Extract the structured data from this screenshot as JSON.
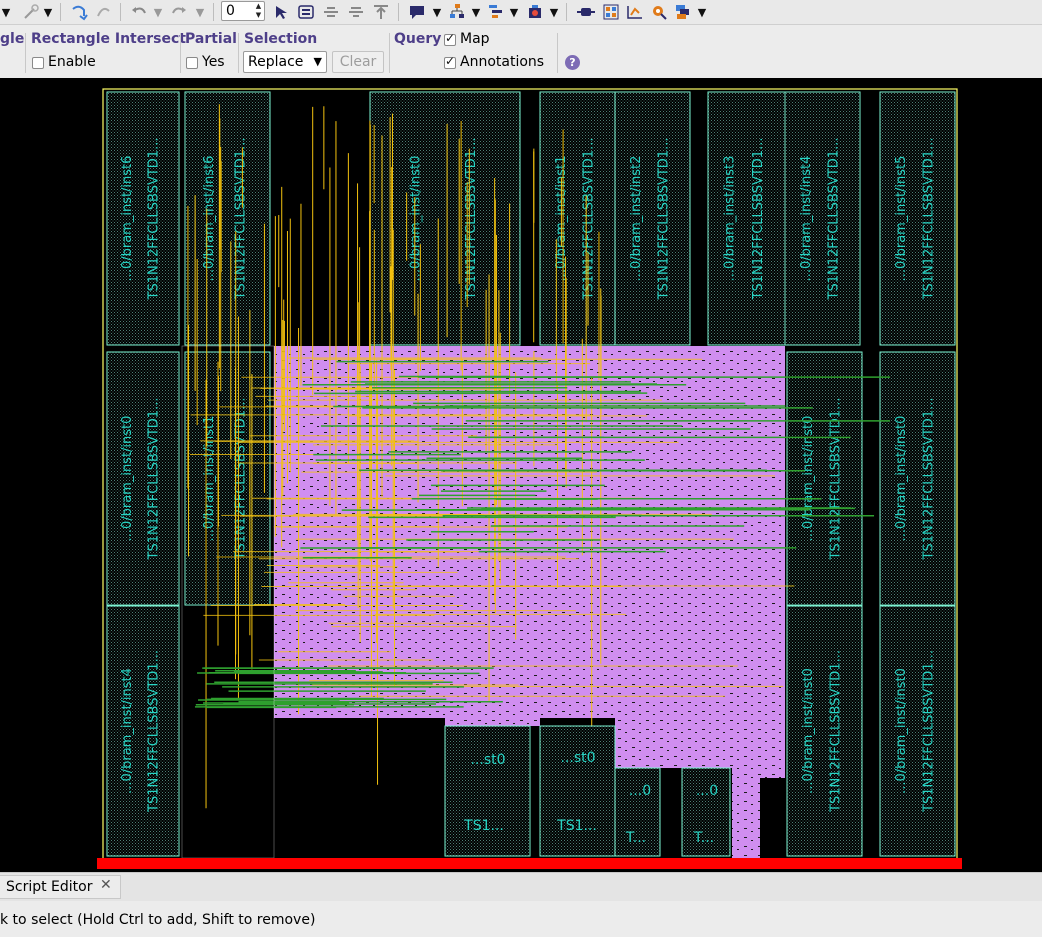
{
  "toolbar": {
    "spinner_value": "0",
    "icons": [
      "wand-icon",
      "wand-back-icon",
      "undo-icon",
      "redo-icon",
      "cursor-icon",
      "camera-icon",
      "align-center-icon",
      "align-middle-icon",
      "align-top-icon",
      "comment-icon",
      "hierarchy-icon",
      "grid-tree-icon",
      "package-icon",
      "chip-icon",
      "schematic-icon",
      "route-icon",
      "search-marker-icon",
      "layers-icon"
    ]
  },
  "options": {
    "partial_prev_label": "gle",
    "rect_intersect": {
      "title": "Rectangle Intersect",
      "enable_label": "Enable",
      "checked": false
    },
    "partial": {
      "title": "Partial",
      "yes_label": "Yes",
      "checked": false
    },
    "selection": {
      "title": "Selection",
      "mode": "Replace",
      "clear_label": "Clear"
    },
    "query": {
      "title": "Query",
      "map_label": "Map",
      "map_checked": true,
      "annotations_label": "Annotations",
      "annotations_checked": true
    },
    "help_label": "?"
  },
  "canvas": {
    "colors": {
      "background": "#000000",
      "cell_fill": "#2e4a44",
      "cell_border": "#7cf3d2",
      "cell_text": "#27d4c4",
      "logic": "#d08ef0",
      "wire_yellow": "#f3c20f",
      "wire_green": "#2fa02f",
      "die_outline": "#ffff66",
      "bottom_bar": "#ff0000"
    },
    "bram_labels": [
      {
        "name": "...0/bram_inst/inst6",
        "type": "TS1N12FFCLLSBSVTD1..."
      },
      {
        "name": "...0/bram_inst/inst6",
        "type": "TS1N12FFCLLSBSVTD1..."
      },
      {
        "name": "...0/bram_inst/inst0",
        "type": "TS1N12FFCLLSBSVTD1..."
      },
      {
        "name": "...0/bram_inst/inst1",
        "type": "TS1N12FFCLLSBSVTD1..."
      },
      {
        "name": "...0/bram_inst/inst2",
        "type": "TS1N12FFCLLSBSVTD1..."
      },
      {
        "name": "...0/bram_inst/inst3",
        "type": "TS1N12FFCLLSBSVTD1..."
      },
      {
        "name": "...0/bram_inst/inst4",
        "type": "TS1N12FFCLLSBSVTD1..."
      },
      {
        "name": "...0/bram_inst/inst5",
        "type": "TS1N12FFCLLSBSVTD1..."
      },
      {
        "name": "...0/bram_inst/inst0",
        "type": "TS1N12FFCLLSBSVTD1..."
      },
      {
        "name": "...0/bram_inst/inst1",
        "type": "TS1N12FFCLLSBSVTD1..."
      },
      {
        "name": "...0/bram_inst/inst0",
        "type": "TS1N12FFCLLSBSVTD1..."
      },
      {
        "name": "...0/bram_inst/inst0",
        "type": "TS1N12FFCLLSBSVTD1..."
      },
      {
        "name": "...0/bram_inst/inst4",
        "type": "TS1N12FFCLLSBSVTD1..."
      },
      {
        "name": "...0/bram_inst/inst0",
        "type": "TS1N12FFCLLSBSVTD1..."
      },
      {
        "name": "...0/bram_inst/inst0",
        "type": "TS1N12FFCLLSBSVTD1..."
      }
    ],
    "small_labels": [
      "...st0",
      "...st0",
      "TS1...",
      "TS1...",
      "...0",
      "...0",
      "T...",
      "T..."
    ]
  },
  "bottom": {
    "tab_label": "Script Editor",
    "tab_close": "✕",
    "status": "k to select (Hold Ctrl to add, Shift to remove)"
  }
}
